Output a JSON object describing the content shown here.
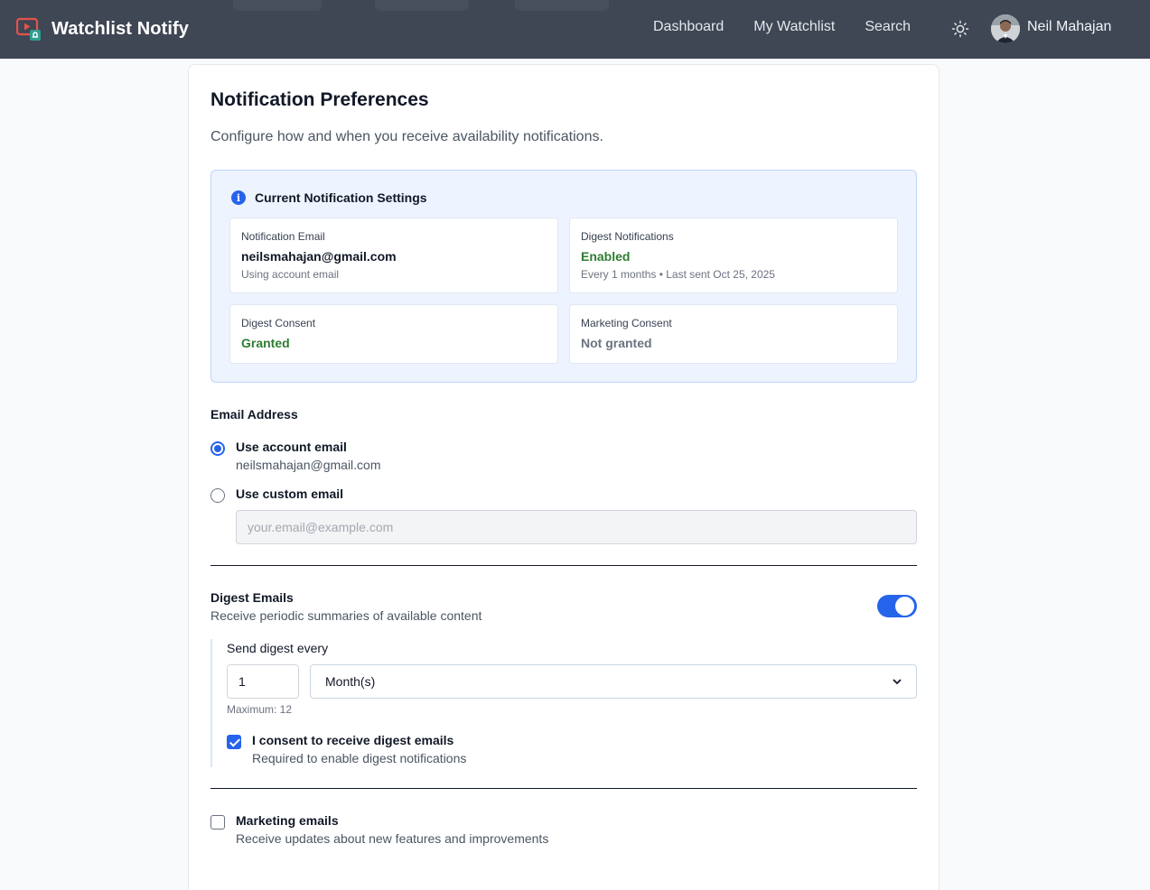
{
  "header": {
    "brand": "Watchlist Notify",
    "nav": [
      "Dashboard",
      "My Watchlist",
      "Search"
    ],
    "user_name": "Neil Mahajan",
    "icons": {
      "logo": "play-bell-logo-icon",
      "theme": "sun-icon"
    }
  },
  "page": {
    "title": "Notification Preferences",
    "subtitle": "Configure how and when you receive availability notifications."
  },
  "current_settings": {
    "title": "Current Notification Settings",
    "notification_email": {
      "label": "Notification Email",
      "value": "neilsmahajan@gmail.com",
      "sub": "Using account email"
    },
    "digest_notifications": {
      "label": "Digest Notifications",
      "value": "Enabled",
      "sub": "Every 1 months • Last sent Oct 25, 2025"
    },
    "digest_consent": {
      "label": "Digest Consent",
      "value": "Granted"
    },
    "marketing_consent": {
      "label": "Marketing Consent",
      "value": "Not granted"
    }
  },
  "email_address": {
    "label": "Email Address",
    "account_option": {
      "label": "Use account email",
      "email": "neilsmahajan@gmail.com",
      "selected": true
    },
    "custom_option": {
      "label": "Use custom email",
      "placeholder": "your.email@example.com",
      "selected": false
    }
  },
  "digest": {
    "title": "Digest Emails",
    "description": "Receive periodic summaries of available content",
    "enabled": true,
    "frequency_label": "Send digest every",
    "frequency_value": "1",
    "unit": "Month(s)",
    "max_hint": "Maximum: 12",
    "consent_label": "I consent to receive digest emails",
    "consent_sub": "Required to enable digest notifications",
    "consent_checked": true
  },
  "marketing": {
    "label": "Marketing emails",
    "description": "Receive updates about new features and improvements",
    "checked": false
  },
  "colors": {
    "header_bg": "#3f4654",
    "accent": "#2563eb",
    "success": "#2e7d32",
    "info_bg": "#eef4ff"
  }
}
